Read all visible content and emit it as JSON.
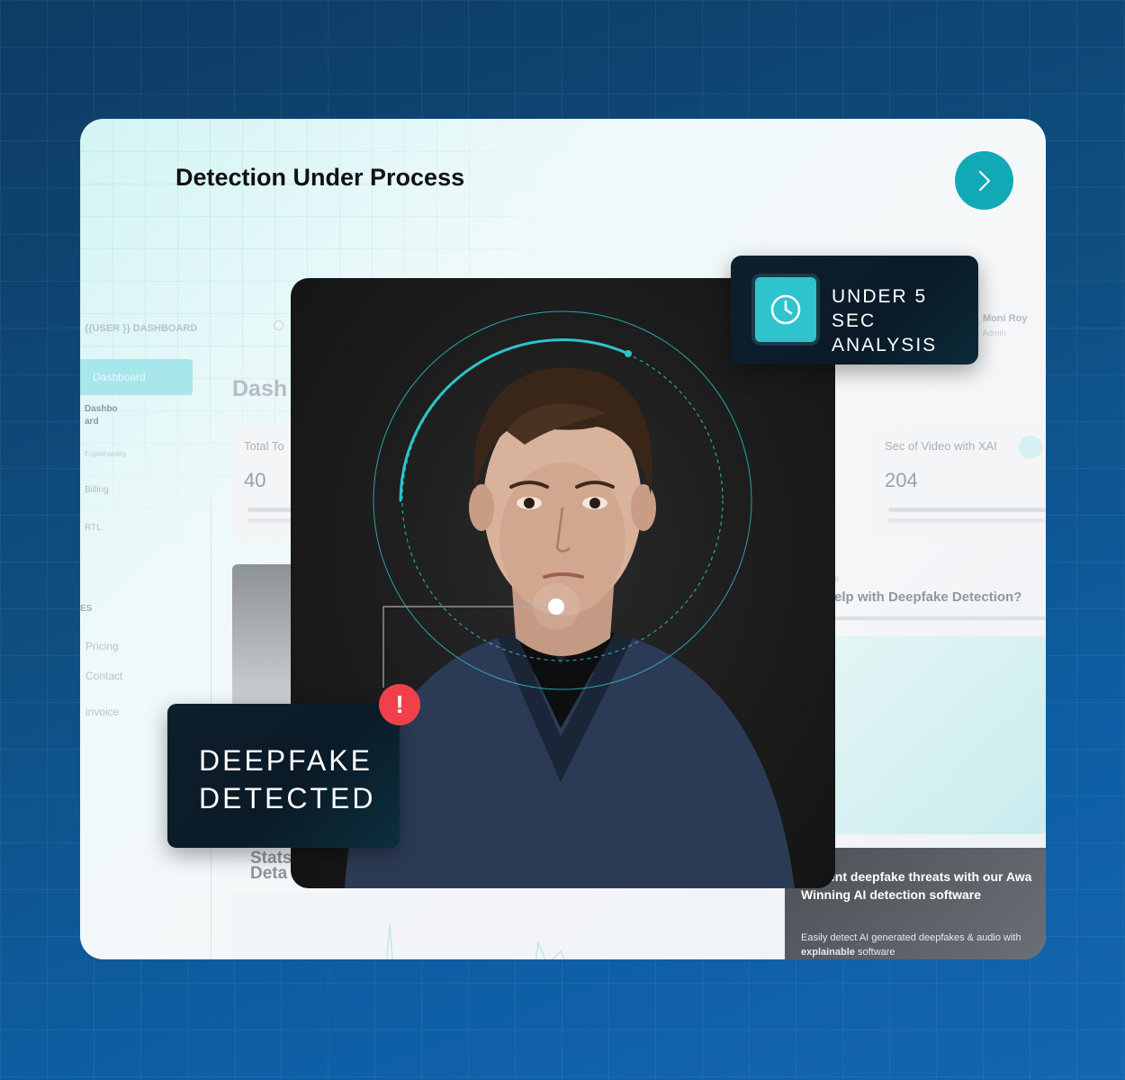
{
  "card": {
    "title": "Detection Under Process"
  },
  "dashboard_bg": {
    "header": "{{USER }} DASHBOARD",
    "user_name": "Moni Roy",
    "user_role": "Admin",
    "page_heading": "Dash",
    "nav_active": "Dashboard",
    "nav_items": [
      "Dashbo",
      "ard",
      "Explainability",
      "Billing",
      "RTL"
    ],
    "section_label": "ES",
    "page_items": [
      "Pricing",
      "Contact",
      "invoice"
    ],
    "stat_left_label": "Total To",
    "stat_left_value": "40",
    "stat_right_label": "Sec of Video with XAI",
    "stat_right_value": "204",
    "help_small": "s",
    "help_heading": "elp with Deepfake Detection?",
    "stats_line1": "Stats",
    "stats_line2": "Deta",
    "promo_line1": "ent deepfake threats with our Awa",
    "promo_line2": "Winning AI detection software",
    "promo_body1": "Easily detect AI generated deepfakes & audio with",
    "promo_body2_bold": "explainable",
    "promo_body2_rest": " software"
  },
  "badges": {
    "analysis_line1": "UNDER 5 SEC",
    "analysis_line2": "ANALYSIS",
    "deepfake_line1": "DEEPFAKE",
    "deepfake_line2": "DETECTED",
    "alert_symbol": "!"
  },
  "icons": {
    "next": "chevron-right-icon",
    "clock": "clock-icon",
    "alert": "exclamation-icon"
  },
  "colors": {
    "accent_teal": "#12a9b6",
    "clock_teal": "#2ec3cd",
    "alert_red": "#f0414b",
    "badge_dark": "#0f1f2d"
  }
}
